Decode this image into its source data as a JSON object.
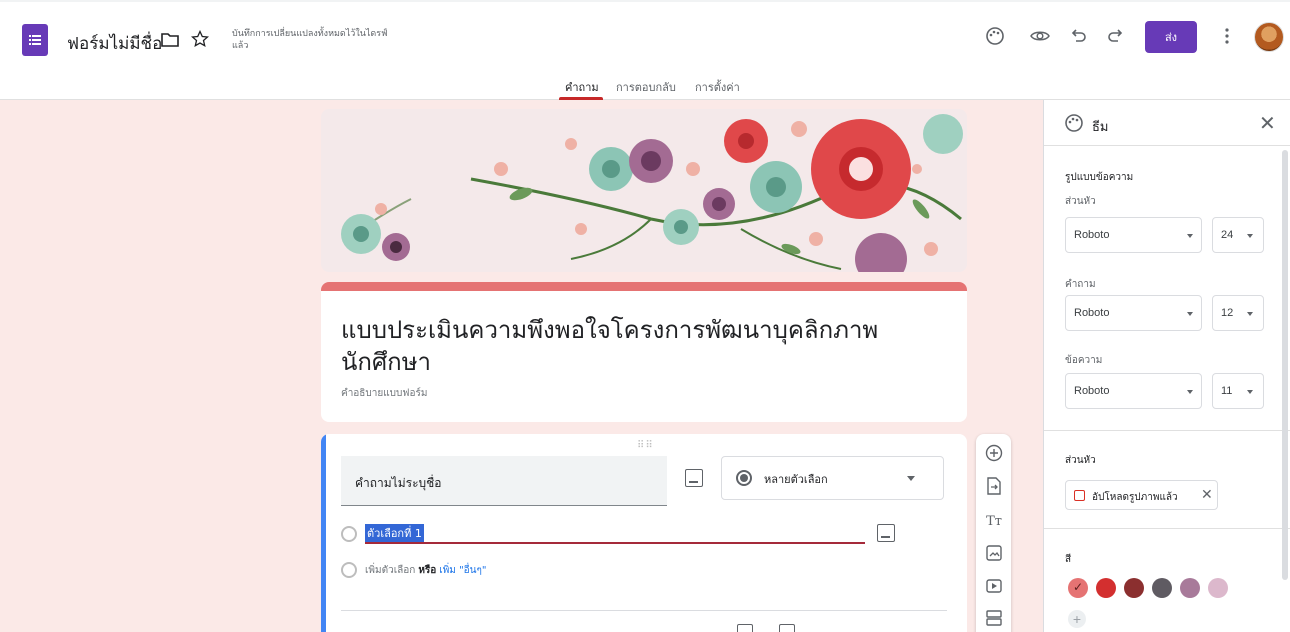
{
  "header": {
    "form_title": "ฟอร์มไม่มีชื่อ",
    "saved_note": "บันทึกการเปลี่ยนแปลงทั้งหมดไว้ในไดรฟ์แล้ว",
    "send_label": "ส่ง",
    "icons": [
      "folder-icon",
      "star-icon",
      "palette-icon",
      "preview-icon",
      "undo-icon",
      "redo-icon",
      "more-icon"
    ]
  },
  "tabs": [
    {
      "label": "คำถาม",
      "active": true
    },
    {
      "label": "การตอบกลับ",
      "active": false
    },
    {
      "label": "การตั้งค่า",
      "active": false
    }
  ],
  "form": {
    "heading": "แบบประเมินความพึงพอใจโครงการพัฒนาบุคลิกภาพนักศึกษา",
    "description": "คำอธิบายแบบฟอร์ม"
  },
  "question": {
    "title": "คำถามไม่ระบุชื่อ",
    "type": "หลายตัวเลือก",
    "option_1": "ตัวเลือกที่ 1",
    "add_option": "เพิ่มตัวเลือก",
    "or": "หรือ",
    "add_other": "เพิ่ม \"อื่นๆ\""
  },
  "theme_panel": {
    "title": "ธีม",
    "text_style_label": "รูปแบบข้อความ",
    "header_label": "ส่วนหัว",
    "header_font": "Roboto",
    "header_size": "24",
    "question_label": "คำถาม",
    "question_font": "Roboto",
    "question_size": "12",
    "text_label": "ข้อความ",
    "text_font": "Roboto",
    "text_size": "11",
    "header_image_label": "ส่วนหัว",
    "uploaded_chip": "อัปโหลดรูปภาพแล้ว",
    "color_label": "สี",
    "colors": [
      "#e57373",
      "#d32f2f",
      "#8b2f2f",
      "#5f5b62",
      "#a87a9a",
      "#dcb8cc"
    ],
    "selected_color": "#e57373"
  }
}
